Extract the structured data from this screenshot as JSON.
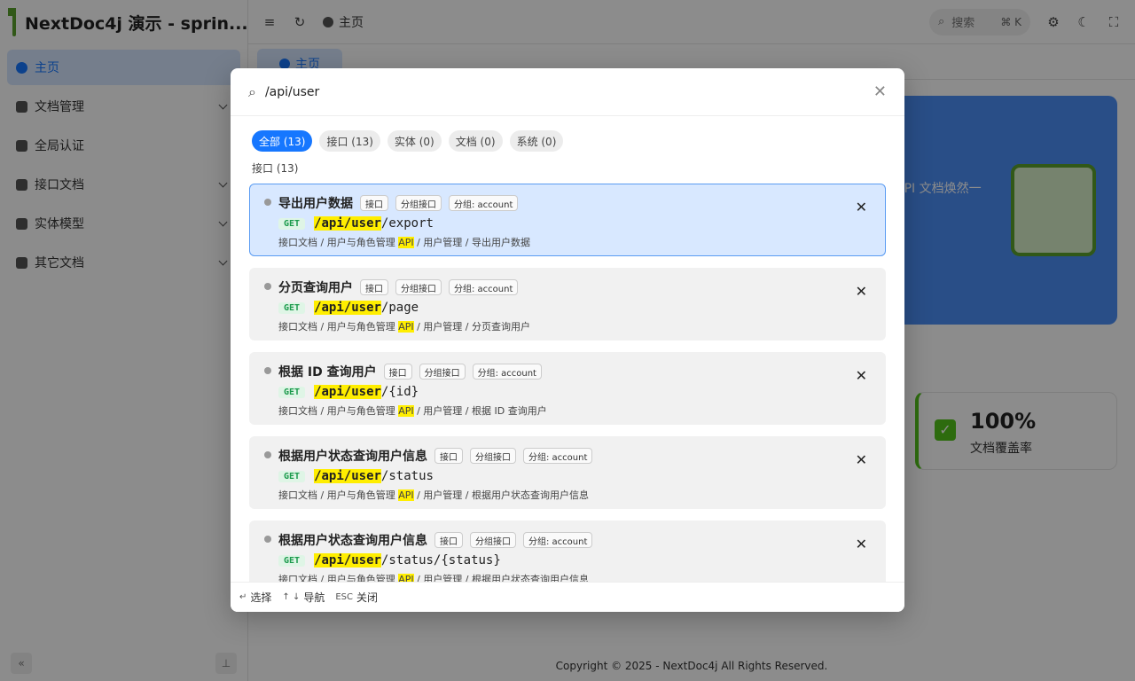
{
  "sidebar": {
    "brand": "NextDoc4j 演示 - sprin...",
    "items": [
      {
        "label": "主页",
        "active": true,
        "icon": "home-icon"
      },
      {
        "label": "文档管理",
        "icon": "document-icon",
        "expandable": true
      },
      {
        "label": "全局认证",
        "icon": "shield-icon"
      },
      {
        "label": "接口文档",
        "icon": "api-icon",
        "expandable": true
      },
      {
        "label": "实体模型",
        "icon": "cube-icon",
        "expandable": true
      },
      {
        "label": "其它文档",
        "icon": "edit-icon",
        "expandable": true
      }
    ]
  },
  "topbar": {
    "breadcrumb": "主页",
    "search_label": "搜索",
    "search_shortcut": "⌘ K"
  },
  "tabs": [
    {
      "label": "主页"
    }
  ],
  "hero": {
    "text": "API 文档焕然一"
  },
  "stat": {
    "value": "100%",
    "label": "文档覆盖率"
  },
  "copyright": "Copyright © 2025 - NextDoc4j All Rights Reserved.",
  "modal": {
    "query": "/api/user",
    "filters": [
      {
        "label": "全部 (13)",
        "active": true
      },
      {
        "label": "接口 (13)"
      },
      {
        "label": "实体 (0)"
      },
      {
        "label": "文档 (0)"
      },
      {
        "label": "系统 (0)"
      }
    ],
    "group_title": "接口 (13)",
    "highlight": "/api/user",
    "crumb_prefix": "接口文档 / 用户与角色管理 ",
    "crumb_hl": "API",
    "results": [
      {
        "title": "导出用户数据",
        "tags": [
          "接口",
          "分组接口",
          "分组: account"
        ],
        "method": "GET",
        "path_rest": "/export",
        "crumb_suffix": " / 用户管理 / 导出用户数据",
        "selected": true
      },
      {
        "title": "分页查询用户",
        "tags": [
          "接口",
          "分组接口",
          "分组: account"
        ],
        "method": "GET",
        "path_rest": "/page",
        "crumb_suffix": " / 用户管理 / 分页查询用户"
      },
      {
        "title": "根据 ID 查询用户",
        "tags": [
          "接口",
          "分组接口",
          "分组: account"
        ],
        "method": "GET",
        "path_rest": "/{id}",
        "crumb_suffix": " / 用户管理 / 根据 ID 查询用户"
      },
      {
        "title": "根据用户状态查询用户信息",
        "tags": [
          "接口",
          "分组接口",
          "分组: account"
        ],
        "method": "GET",
        "path_rest": "/status",
        "crumb_suffix": " / 用户管理 / 根据用户状态查询用户信息"
      },
      {
        "title": "根据用户状态查询用户信息",
        "tags": [
          "接口",
          "分组接口",
          "分组: account"
        ],
        "method": "GET",
        "path_rest": "/status/{status}",
        "crumb_suffix": " / 用户管理 / 根据用户状态查询用户信息"
      }
    ],
    "footer": {
      "select_key": "↵",
      "select_label": "选择",
      "nav_key": "↑ ↓",
      "nav_label": "导航",
      "close_key": "ESC",
      "close_label": "关闭"
    }
  }
}
